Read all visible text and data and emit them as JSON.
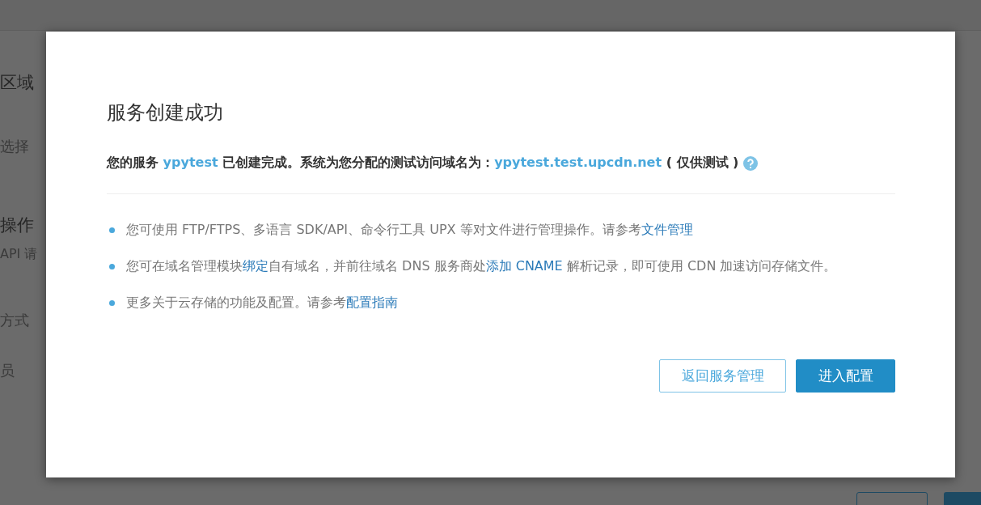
{
  "background": {
    "labels": [
      {
        "text": "区域",
        "kind": "heading"
      },
      {
        "text": "选择",
        "kind": "label"
      },
      {
        "text": "操作",
        "kind": "heading"
      },
      {
        "text": "API 请",
        "kind": "label"
      },
      {
        "text": "方式",
        "kind": "label"
      },
      {
        "text": "员",
        "kind": "label"
      }
    ],
    "buttons": [
      {
        "kind": "outline"
      },
      {
        "kind": "primary"
      }
    ]
  },
  "modal": {
    "title": "服务创建成功",
    "message": [
      {
        "text": "您的服务 ",
        "kind": "plain"
      },
      {
        "text": "ypytest",
        "kind": "link"
      },
      {
        "text": " 已创建完成。系统为您分配的测试访问域名为：",
        "kind": "plain"
      },
      {
        "text": "ypytest.test.upcdn.net",
        "kind": "link"
      },
      {
        "text": " ( 仅供测试 )",
        "kind": "plain"
      }
    ],
    "bullets": [
      [
        {
          "text": "您可使用 FTP/FTPS、多语言 SDK/API、命令行工具 UPX 等对文件进行管理操作。请参考",
          "kind": "plain"
        },
        {
          "text": "文件管理",
          "kind": "link"
        }
      ],
      [
        {
          "text": "您可在域名管理模块",
          "kind": "plain"
        },
        {
          "text": "绑定",
          "kind": "link"
        },
        {
          "text": "自有域名，并前往域名 DNS 服务商处",
          "kind": "plain"
        },
        {
          "text": "添加 CNAME",
          "kind": "link"
        },
        {
          "text": " 解析记录，即可使用 CDN 加速访问存储文件。",
          "kind": "plain"
        }
      ],
      [
        {
          "text": "更多关于云存储的功能及配置。请参考",
          "kind": "plain"
        },
        {
          "text": "配置指南",
          "kind": "link"
        }
      ]
    ],
    "buttons": [
      {
        "label": "返回服务管理",
        "kind": "secondary"
      },
      {
        "label": "进入配置",
        "kind": "primary"
      }
    ]
  }
}
